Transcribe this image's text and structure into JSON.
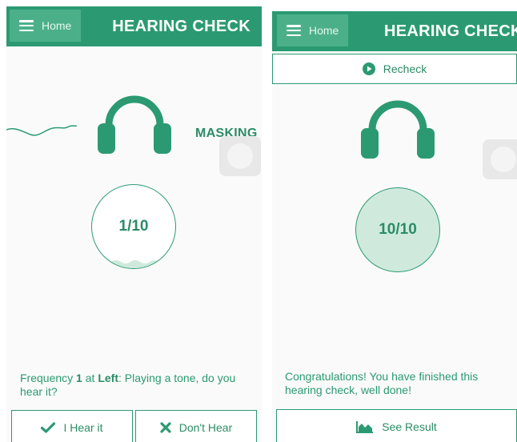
{
  "left_screen": {
    "home_label": "Home",
    "title": "HEARING CHECK",
    "masking_label": "MASKING",
    "progress": "1/10",
    "status": {
      "prefix": "Frequency ",
      "frequency": "1",
      "middle": " at ",
      "side": "Left",
      "suffix": ": Playing a tone, do you hear it?"
    },
    "hear_label": "I Hear it",
    "dont_hear_label": "Don't Hear"
  },
  "right_screen": {
    "home_label": "Home",
    "title": "HEARING CHECK",
    "recheck_label": "Recheck",
    "progress": "10/10",
    "status": "Congratulations! You have finished this hearing check, well done!",
    "see_result_label": "See Result"
  },
  "icons": {
    "menu": "hamburger-icon",
    "headphones": "headphones-icon",
    "check": "checkmark-icon",
    "cross": "x-icon",
    "play": "play-circle-icon",
    "chart": "area-chart-icon"
  },
  "colors": {
    "primary": "#2b9a72",
    "primary_light": "#4bb08a",
    "circle_fill": "#cfeadd",
    "toggle": "#e8e8e8"
  }
}
